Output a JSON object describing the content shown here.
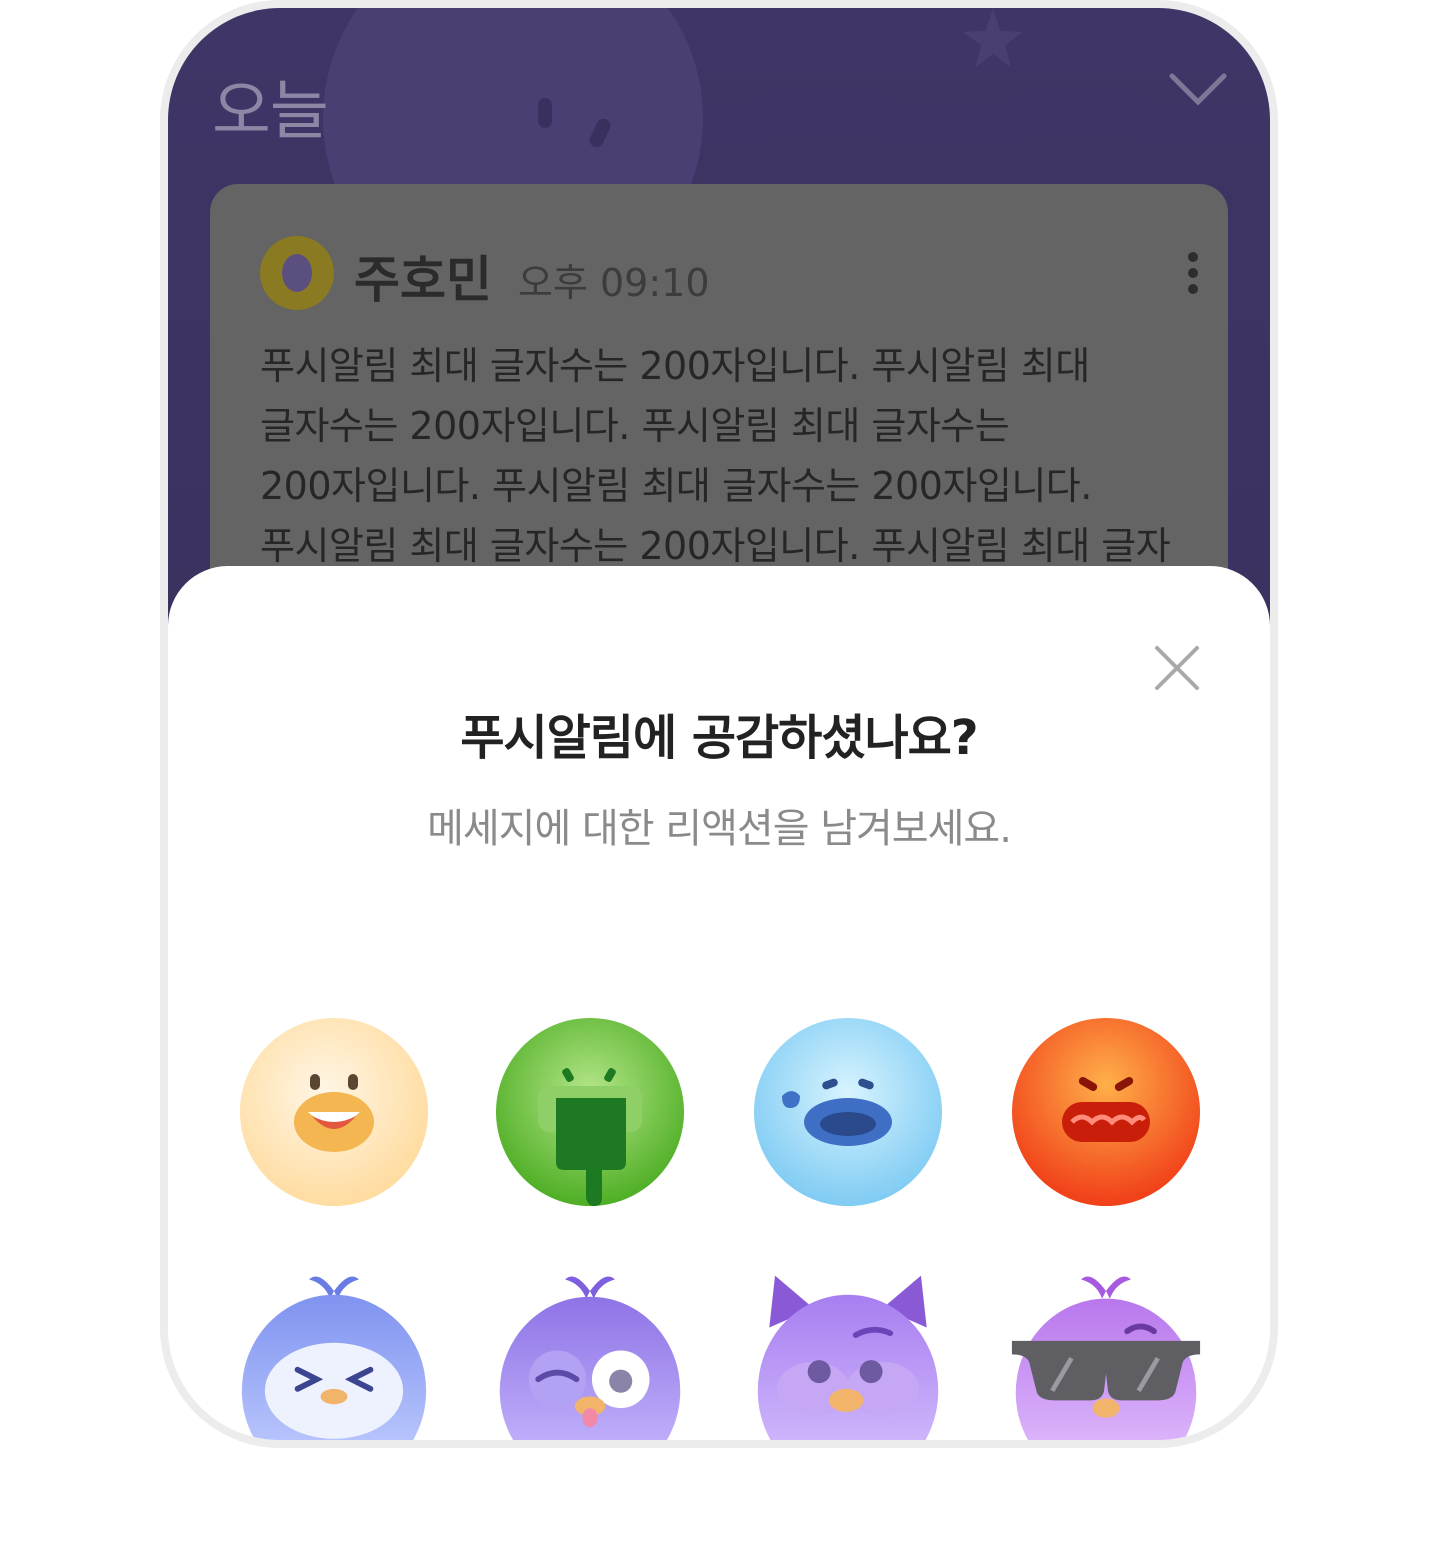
{
  "header": {
    "title": "오늘"
  },
  "message": {
    "sender": "주호민",
    "time": "오후 09:10",
    "body": "푸시알림 최대 글자수는 200자입니다. 푸시알림 최대 글자수는 200자입니다. 푸시알림 최대 글자수는 200자입니다. 푸시알림 최대 글자수는 200자입니다. 푸시알림 최대 글자수는 200자입니다. 푸시알림 최대 글자"
  },
  "sheet": {
    "title": "푸시알림에 공감하셨나요?",
    "subtitle": "메세지에 대한 리액션을 남겨보세요."
  },
  "reactions": [
    {
      "icon": "laughing-face-icon",
      "color": "#ffe3ae"
    },
    {
      "icon": "thumbs-down-icon",
      "color": "#6fc13a"
    },
    {
      "icon": "crying-face-icon",
      "color": "#8fd4f6"
    },
    {
      "icon": "angry-face-icon",
      "color": "#f7561e"
    },
    {
      "icon": "blue-bird-laughing-icon",
      "color": "#8b9cf2"
    },
    {
      "icon": "purple-bird-winking-icon",
      "color": "#9a86ea"
    },
    {
      "icon": "purple-owl-icon",
      "color": "#b38cf0"
    },
    {
      "icon": "pink-bird-sunglasses-icon",
      "color": "#c98af0"
    }
  ]
}
